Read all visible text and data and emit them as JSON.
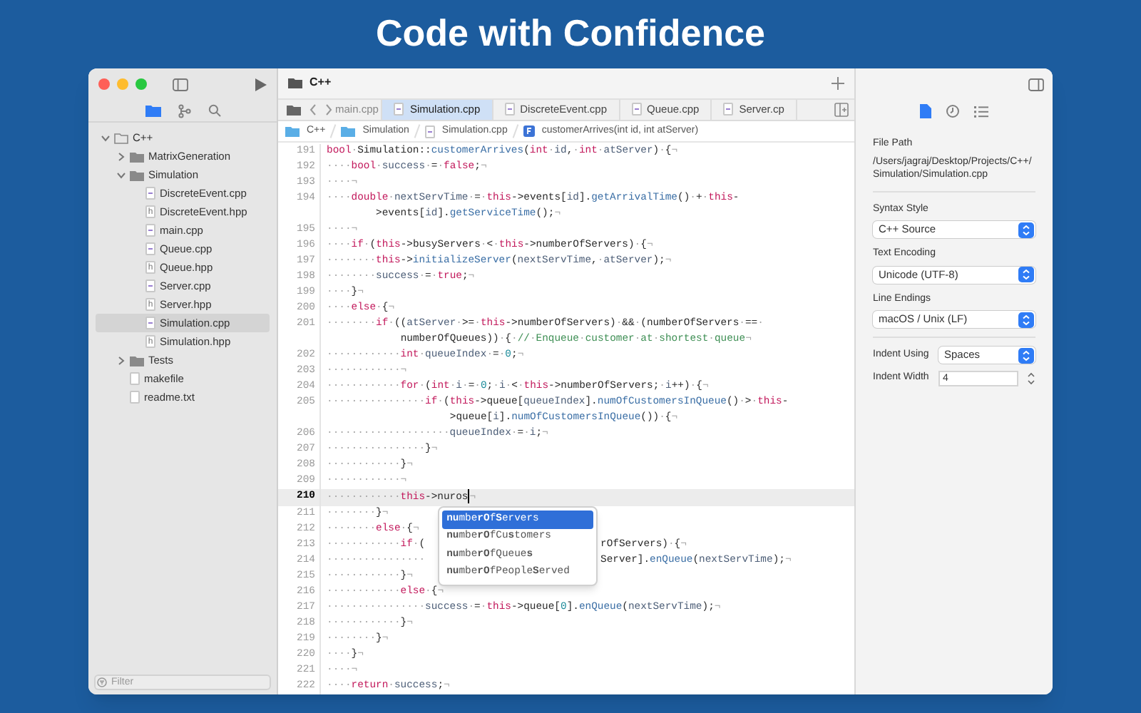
{
  "page_title": "Code with Confidence",
  "sidebar": {
    "tabs": [
      {
        "kind": "files",
        "selected": true
      },
      {
        "kind": "git",
        "selected": false
      },
      {
        "kind": "search",
        "selected": false
      }
    ],
    "tree": [
      {
        "name": "C++",
        "kind": "root",
        "expanded": true,
        "selected": false,
        "children": [
          {
            "name": "MatrixGeneration",
            "kind": "folder",
            "expanded": false,
            "selected": false
          },
          {
            "name": "Simulation",
            "kind": "folder",
            "expanded": true,
            "selected": false,
            "children": [
              {
                "name": "DiscreteEvent.cpp",
                "kind": "cpp",
                "selected": false
              },
              {
                "name": "DiscreteEvent.hpp",
                "kind": "hpp",
                "icon_text": "h",
                "selected": false
              },
              {
                "name": "main.cpp",
                "kind": "cpp",
                "selected": false
              },
              {
                "name": "Queue.cpp",
                "kind": "cpp",
                "selected": false
              },
              {
                "name": "Queue.hpp",
                "kind": "hpp",
                "icon_text": "h",
                "selected": false
              },
              {
                "name": "Server.cpp",
                "kind": "cpp",
                "selected": false
              },
              {
                "name": "Server.hpp",
                "kind": "hpp",
                "icon_text": "h",
                "selected": false
              },
              {
                "name": "Simulation.cpp",
                "kind": "cpp",
                "selected": true
              },
              {
                "name": "Simulation.hpp",
                "kind": "hpp",
                "icon_text": "h",
                "selected": false
              }
            ]
          },
          {
            "name": "Tests",
            "kind": "folder",
            "expanded": false,
            "selected": false
          },
          {
            "name": "makefile",
            "kind": "file",
            "selected": false
          },
          {
            "name": "readme.txt",
            "kind": "file",
            "selected": false
          }
        ]
      }
    ],
    "filter": {
      "placeholder": "Filter"
    }
  },
  "editor": {
    "title": "C++",
    "tabs": [
      {
        "label": "main.cpp",
        "selected": false,
        "clipped": true
      },
      {
        "label": "Simulation.cpp",
        "selected": true,
        "clipped": false
      },
      {
        "label": "DiscreteEvent.cpp",
        "selected": false,
        "clipped": false
      },
      {
        "label": "Queue.cpp",
        "selected": false,
        "clipped": false
      },
      {
        "label": "Server.cp",
        "selected": false,
        "clipped": false
      }
    ],
    "breadcrumbs": [
      {
        "label": "C++",
        "kind": "folder"
      },
      {
        "label": "Simulation",
        "kind": "folder"
      },
      {
        "label": "Simulation.cpp",
        "kind": "file"
      },
      {
        "label": "customerArrives(int id, int atServer)",
        "kind": "function"
      }
    ],
    "lines": [
      {
        "number": "191",
        "current": false,
        "tokens": [
          {
            "kind": "kw",
            "text": "bool"
          },
          {
            "kind": "p",
            "text": "·Simulation::"
          },
          {
            "kind": "fn",
            "text": "customerArrives"
          },
          {
            "kind": "p",
            "text": "("
          },
          {
            "kind": "kw",
            "text": "int"
          },
          {
            "kind": "v",
            "text": "·id"
          },
          {
            "kind": "p",
            "text": ",·"
          },
          {
            "kind": "kw",
            "text": "int"
          },
          {
            "kind": "v",
            "text": "·atServer"
          },
          {
            "kind": "p",
            "text": ")·{¬"
          }
        ]
      },
      {
        "number": "192",
        "current": false,
        "tokens": [
          {
            "kind": "p",
            "text": "····"
          },
          {
            "kind": "kw",
            "text": "bool"
          },
          {
            "kind": "v",
            "text": "·success"
          },
          {
            "kind": "p",
            "text": "·=·"
          },
          {
            "kind": "kw",
            "text": "false"
          },
          {
            "kind": "p",
            "text": ";¬"
          }
        ]
      },
      {
        "number": "193",
        "current": false,
        "tokens": [
          {
            "kind": "p",
            "text": "····¬"
          }
        ]
      },
      {
        "number": "194",
        "current": false,
        "tokens": [
          {
            "kind": "p",
            "text": "····"
          },
          {
            "kind": "kw",
            "text": "double"
          },
          {
            "kind": "v",
            "text": "·nextServTime"
          },
          {
            "kind": "p",
            "text": "·=·"
          },
          {
            "kind": "kw",
            "text": "this"
          },
          {
            "kind": "p",
            "text": "->events["
          },
          {
            "kind": "v",
            "text": "id"
          },
          {
            "kind": "p",
            "text": "]."
          },
          {
            "kind": "fn",
            "text": "getArrivalTime"
          },
          {
            "kind": "p",
            "text": "()·+·"
          },
          {
            "kind": "kw",
            "text": "this"
          },
          {
            "kind": "p",
            "text": "-"
          }
        ],
        "continuation": [
          {
            "kind": "p",
            "text": ">events["
          },
          {
            "kind": "v",
            "text": "id"
          },
          {
            "kind": "p",
            "text": "]."
          },
          {
            "kind": "fn",
            "text": "getServiceTime"
          },
          {
            "kind": "p",
            "text": "();¬"
          }
        ]
      },
      {
        "number": "195",
        "current": false,
        "tokens": [
          {
            "kind": "p",
            "text": "····¬"
          }
        ]
      },
      {
        "number": "196",
        "current": false,
        "tokens": [
          {
            "kind": "p",
            "text": "····"
          },
          {
            "kind": "kw",
            "text": "if"
          },
          {
            "kind": "p",
            "text": "·("
          },
          {
            "kind": "kw",
            "text": "this"
          },
          {
            "kind": "p",
            "text": "->busyServers·<·"
          },
          {
            "kind": "kw",
            "text": "this"
          },
          {
            "kind": "p",
            "text": "->numberOfServers)·{¬"
          }
        ]
      },
      {
        "number": "197",
        "current": false,
        "tokens": [
          {
            "kind": "p",
            "text": "········"
          },
          {
            "kind": "kw",
            "text": "this"
          },
          {
            "kind": "p",
            "text": "->"
          },
          {
            "kind": "fn",
            "text": "initializeServer"
          },
          {
            "kind": "p",
            "text": "("
          },
          {
            "kind": "v",
            "text": "nextServTime"
          },
          {
            "kind": "p",
            "text": ",·"
          },
          {
            "kind": "v",
            "text": "atServer"
          },
          {
            "kind": "p",
            "text": ");¬"
          }
        ]
      },
      {
        "number": "198",
        "current": false,
        "tokens": [
          {
            "kind": "p",
            "text": "········"
          },
          {
            "kind": "v",
            "text": "success"
          },
          {
            "kind": "p",
            "text": "·=·"
          },
          {
            "kind": "kw",
            "text": "true"
          },
          {
            "kind": "p",
            "text": ";¬"
          }
        ]
      },
      {
        "number": "199",
        "current": false,
        "tokens": [
          {
            "kind": "p",
            "text": "····}¬"
          }
        ]
      },
      {
        "number": "200",
        "current": false,
        "tokens": [
          {
            "kind": "p",
            "text": "····"
          },
          {
            "kind": "kw",
            "text": "else"
          },
          {
            "kind": "p",
            "text": "·{¬"
          }
        ]
      },
      {
        "number": "201",
        "current": false,
        "tokens": [
          {
            "kind": "p",
            "text": "········"
          },
          {
            "kind": "kw",
            "text": "if"
          },
          {
            "kind": "p",
            "text": "·(("
          },
          {
            "kind": "v",
            "text": "atServer"
          },
          {
            "kind": "p",
            "text": "·>=·"
          },
          {
            "kind": "kw",
            "text": "this"
          },
          {
            "kind": "p",
            "text": "->numberOfServers)·&&·(numberOfServers·==·"
          }
        ],
        "continuation": [
          {
            "kind": "p",
            "text": "numberOfQueues))·{·"
          },
          {
            "kind": "c",
            "text": "//·Enqueue·customer·at·shortest·queue"
          },
          {
            "kind": "p",
            "text": "¬"
          }
        ]
      },
      {
        "number": "202",
        "current": false,
        "tokens": [
          {
            "kind": "p",
            "text": "············"
          },
          {
            "kind": "kw",
            "text": "int"
          },
          {
            "kind": "v",
            "text": "·queueIndex"
          },
          {
            "kind": "p",
            "text": "·=·"
          },
          {
            "kind": "n",
            "text": "0"
          },
          {
            "kind": "p",
            "text": ";¬"
          }
        ]
      },
      {
        "number": "203",
        "current": false,
        "tokens": [
          {
            "kind": "p",
            "text": "············¬"
          }
        ]
      },
      {
        "number": "204",
        "current": false,
        "tokens": [
          {
            "kind": "p",
            "text": "············"
          },
          {
            "kind": "kw",
            "text": "for"
          },
          {
            "kind": "p",
            "text": "·("
          },
          {
            "kind": "kw",
            "text": "int"
          },
          {
            "kind": "v",
            "text": "·i"
          },
          {
            "kind": "p",
            "text": "·=·"
          },
          {
            "kind": "n",
            "text": "0"
          },
          {
            "kind": "p",
            "text": ";·"
          },
          {
            "kind": "v",
            "text": "i"
          },
          {
            "kind": "p",
            "text": "·<·"
          },
          {
            "kind": "kw",
            "text": "this"
          },
          {
            "kind": "p",
            "text": "->numberOfServers;·"
          },
          {
            "kind": "v",
            "text": "i"
          },
          {
            "kind": "p",
            "text": "++)·{¬"
          }
        ]
      },
      {
        "number": "205",
        "current": false,
        "tokens": [
          {
            "kind": "p",
            "text": "················"
          },
          {
            "kind": "kw",
            "text": "if"
          },
          {
            "kind": "p",
            "text": "·("
          },
          {
            "kind": "kw",
            "text": "this"
          },
          {
            "kind": "p",
            "text": "->queue["
          },
          {
            "kind": "v",
            "text": "queueIndex"
          },
          {
            "kind": "p",
            "text": "]."
          },
          {
            "kind": "fn",
            "text": "numOfCustomersInQueue"
          },
          {
            "kind": "p",
            "text": "()·>·"
          },
          {
            "kind": "kw",
            "text": "this"
          },
          {
            "kind": "p",
            "text": "-"
          }
        ],
        "continuation": [
          {
            "kind": "p",
            "text": ">queue["
          },
          {
            "kind": "v",
            "text": "i"
          },
          {
            "kind": "p",
            "text": "]."
          },
          {
            "kind": "fn",
            "text": "numOfCustomersInQueue"
          },
          {
            "kind": "p",
            "text": "())·{¬"
          }
        ]
      },
      {
        "number": "206",
        "current": false,
        "tokens": [
          {
            "kind": "p",
            "text": "····················"
          },
          {
            "kind": "v",
            "text": "queueIndex"
          },
          {
            "kind": "p",
            "text": "·=·"
          },
          {
            "kind": "v",
            "text": "i"
          },
          {
            "kind": "p",
            "text": ";¬"
          }
        ]
      },
      {
        "number": "207",
        "current": false,
        "tokens": [
          {
            "kind": "p",
            "text": "················}¬"
          }
        ]
      },
      {
        "number": "208",
        "current": false,
        "tokens": [
          {
            "kind": "p",
            "text": "············}¬"
          }
        ]
      },
      {
        "number": "209",
        "current": false,
        "tokens": [
          {
            "kind": "p",
            "text": "············¬"
          }
        ]
      },
      {
        "number": "210",
        "current": true,
        "tokens": [
          {
            "kind": "p",
            "text": "············"
          },
          {
            "kind": "kw",
            "text": "this"
          },
          {
            "kind": "p",
            "text": "->nuros"
          },
          {
            "kind": "cursor"
          },
          {
            "kind": "p",
            "text": "¬"
          }
        ]
      },
      {
        "number": "211",
        "current": false,
        "tokens": [
          {
            "kind": "p",
            "text": "········}¬"
          }
        ]
      },
      {
        "number": "212",
        "current": false,
        "tokens": [
          {
            "kind": "p",
            "text": "········"
          },
          {
            "kind": "kw",
            "text": "else"
          },
          {
            "kind": "p",
            "text": "·{¬"
          }
        ]
      },
      {
        "number": "213",
        "current": false,
        "tokens": [
          {
            "kind": "p",
            "text": "············"
          },
          {
            "kind": "kw",
            "text": "if"
          },
          {
            "kind": "p",
            "text": "·("
          }
        ],
        "after_popup": [
          {
            "kind": "p",
            "text": "rOfServers)·{¬"
          }
        ]
      },
      {
        "number": "214",
        "current": false,
        "tokens": [
          {
            "kind": "p",
            "text": "················"
          }
        ],
        "after_popup": [
          {
            "kind": "p",
            "text": "Server]."
          },
          {
            "kind": "fn",
            "text": "enQueue"
          },
          {
            "kind": "p",
            "text": "("
          },
          {
            "kind": "v",
            "text": "nextServTime"
          },
          {
            "kind": "p",
            "text": ");¬"
          }
        ]
      },
      {
        "number": "215",
        "current": false,
        "tokens": [
          {
            "kind": "p",
            "text": "············}¬"
          }
        ]
      },
      {
        "number": "216",
        "current": false,
        "tokens": [
          {
            "kind": "p",
            "text": "············"
          },
          {
            "kind": "kw",
            "text": "else"
          },
          {
            "kind": "p",
            "text": "·{¬"
          }
        ]
      },
      {
        "number": "217",
        "current": false,
        "tokens": [
          {
            "kind": "p",
            "text": "················"
          },
          {
            "kind": "v",
            "text": "success"
          },
          {
            "kind": "p",
            "text": "·=·"
          },
          {
            "kind": "kw",
            "text": "this"
          },
          {
            "kind": "p",
            "text": "->queue["
          },
          {
            "kind": "n",
            "text": "0"
          },
          {
            "kind": "p",
            "text": "]."
          },
          {
            "kind": "fn",
            "text": "enQueue"
          },
          {
            "kind": "p",
            "text": "("
          },
          {
            "kind": "v",
            "text": "nextServTime"
          },
          {
            "kind": "p",
            "text": ");¬"
          }
        ]
      },
      {
        "number": "218",
        "current": false,
        "tokens": [
          {
            "kind": "p",
            "text": "············}¬"
          }
        ]
      },
      {
        "number": "219",
        "current": false,
        "tokens": [
          {
            "kind": "p",
            "text": "········}¬"
          }
        ]
      },
      {
        "number": "220",
        "current": false,
        "tokens": [
          {
            "kind": "p",
            "text": "····}¬"
          }
        ]
      },
      {
        "number": "221",
        "current": false,
        "tokens": [
          {
            "kind": "p",
            "text": "····¬"
          }
        ]
      },
      {
        "number": "222",
        "current": false,
        "tokens": [
          {
            "kind": "p",
            "text": "····"
          },
          {
            "kind": "kw",
            "text": "return"
          },
          {
            "kind": "v",
            "text": "·success"
          },
          {
            "kind": "p",
            "text": ";¬"
          }
        ]
      }
    ],
    "completions": [
      {
        "label": "**nu**mbe**rO**f**S**ervers",
        "selected": true
      },
      {
        "label": "**nu**mbe**rO**fCu**s**tomers",
        "selected": false
      },
      {
        "label": "**nu**mbe**rO**fQueue**s**",
        "selected": false
      },
      {
        "label": "**nu**mbe**rO**fPeople**S**erved",
        "selected": false
      }
    ]
  },
  "inspector": {
    "tabs": [
      {
        "kind": "document",
        "selected": true
      },
      {
        "kind": "history",
        "selected": false
      },
      {
        "kind": "outline",
        "selected": false
      }
    ],
    "file_path": {
      "label": "File Path",
      "value": "/Users/jagraj/Desktop/Projects/C++/Simulation/Simulation.cpp"
    },
    "selects": [
      {
        "label": "Syntax Style",
        "value": "C++ Source"
      },
      {
        "label": "Text Encoding",
        "value": "Unicode (UTF-8)"
      },
      {
        "label": "Line Endings",
        "value": "macOS / Unix (LF)"
      }
    ],
    "indent_using": {
      "label": "Indent Using",
      "value": "Spaces"
    },
    "indent_width": {
      "label": "Indent Width",
      "value": "4"
    }
  }
}
